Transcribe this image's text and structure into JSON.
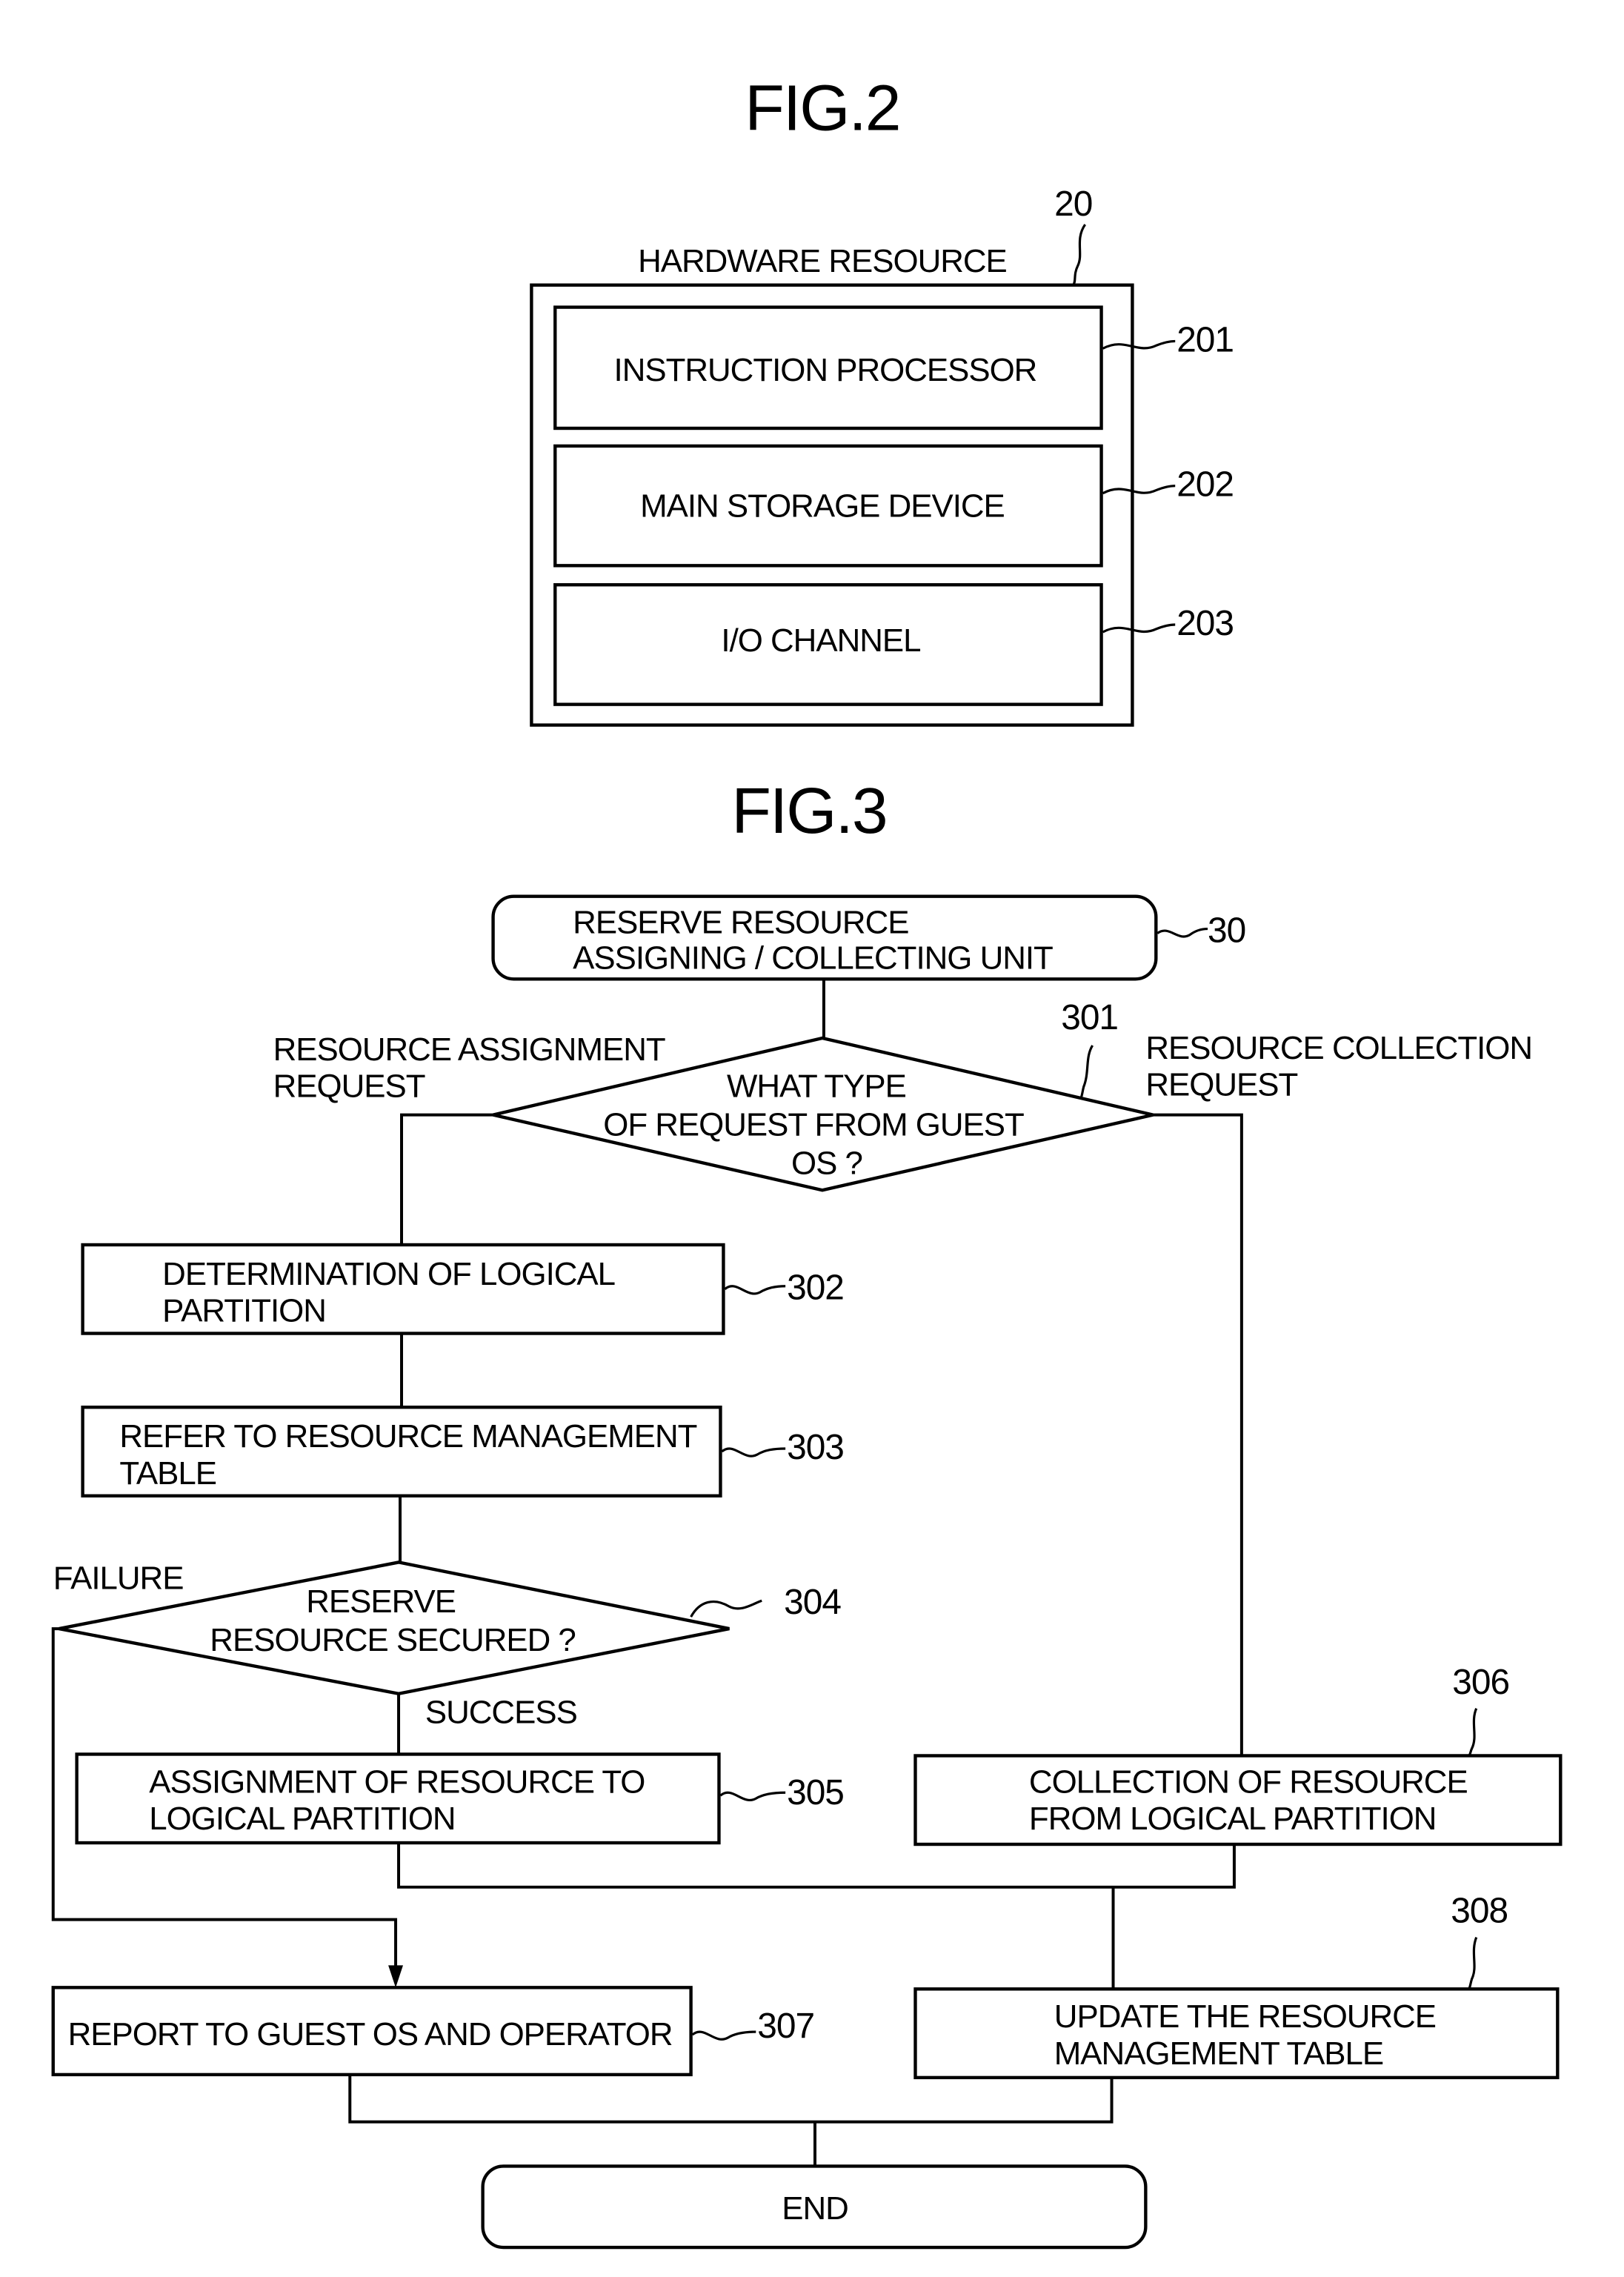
{
  "fig2": {
    "title": "FIG.2",
    "container": {
      "ref": "20",
      "label": "HARDWARE RESOURCE"
    },
    "components": [
      {
        "ref": "201",
        "label": "INSTRUCTION PROCESSOR"
      },
      {
        "ref": "202",
        "label": "MAIN STORAGE DEVICE"
      },
      {
        "ref": "203",
        "label": "I/O CHANNEL"
      }
    ]
  },
  "fig3": {
    "title": "FIG.3",
    "start": {
      "ref": "30",
      "lines": [
        "RESERVE RESOURCE",
        "ASSIGNING / COLLECTING UNIT"
      ]
    },
    "decision_301": {
      "ref": "301",
      "lines": [
        "WHAT TYPE",
        "OF REQUEST FROM GUEST",
        "OS ?"
      ]
    },
    "branch_left": [
      "RESOURCE ASSIGNMENT",
      "REQUEST"
    ],
    "branch_right": [
      "RESOURCE COLLECTION",
      "REQUEST"
    ],
    "step_302": {
      "ref": "302",
      "lines": [
        "DETERMINATION OF LOGICAL",
        "PARTITION"
      ]
    },
    "step_303": {
      "ref": "303",
      "lines": [
        "REFER TO RESOURCE MANAGEMENT",
        "TABLE"
      ]
    },
    "decision_304": {
      "ref": "304",
      "lines": [
        "RESERVE",
        "RESOURCE SECURED ?"
      ]
    },
    "failure_label": "FAILURE",
    "success_label": "SUCCESS",
    "step_305": {
      "ref": "305",
      "lines": [
        "ASSIGNMENT OF RESOURCE TO",
        "LOGICAL PARTITION"
      ]
    },
    "step_306": {
      "ref": "306",
      "lines": [
        "COLLECTION OF RESOURCE",
        "FROM LOGICAL PARTITION"
      ]
    },
    "step_307": {
      "ref": "307",
      "lines": [
        "REPORT TO GUEST OS AND OPERATOR"
      ]
    },
    "step_308": {
      "ref": "308",
      "lines": [
        "UPDATE THE RESOURCE",
        "MANAGEMENT TABLE"
      ]
    },
    "end": {
      "label": "END"
    }
  }
}
